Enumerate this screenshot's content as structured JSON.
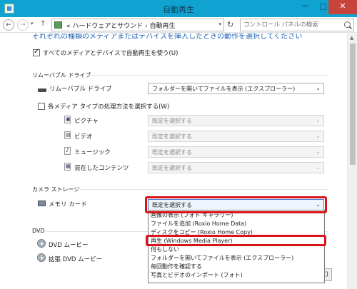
{
  "window": {
    "title": "自動再生",
    "minimize": "─",
    "maximize": "□",
    "close": "✕"
  },
  "nav": {
    "back": "←",
    "forward": "→",
    "history": "▾",
    "up": "↑",
    "address_prefix": "«",
    "breadcrumb": [
      "ハードウェアとサウンド",
      "自動再生"
    ],
    "breadcrumb_sep": "›",
    "address_dropdown": "▾",
    "refresh": "↻",
    "search_placeholder": "コントロール パネルの検索"
  },
  "intro_text": "それぞれの種類のメディアまたはデバイスを挿入したときの動作を選択してください",
  "use_autoplay": {
    "label": "すべてのメディアとデバイスで自動再生を使う(U)",
    "checked": true
  },
  "removable": {
    "section": "リムーバブル ドライブ",
    "drive_label": "リムーバブル ドライブ",
    "drive_value": "フォルダーを開いてファイルを表示 (エクスプローラー)",
    "per_media": {
      "label": "各メディア タイプの処理方法を選択する(W)",
      "checked": false
    },
    "media": [
      {
        "label": "ピクチャ",
        "value": "既定を選択する",
        "icon": "picture-icon"
      },
      {
        "label": "ビデオ",
        "value": "既定を選択する",
        "icon": "video-icon"
      },
      {
        "label": "ミュージック",
        "value": "既定を選択する",
        "icon": "music-icon"
      },
      {
        "label": "混在したコンテンツ",
        "value": "既定を選択する",
        "icon": "mixed-content-icon"
      }
    ]
  },
  "camera": {
    "section": "カメラ ストレージ",
    "memory_card_label": "メモリ カード",
    "memory_card_value": "既定を選択する"
  },
  "dvd": {
    "section": "DVD",
    "items": [
      {
        "label": "DVD ムービー"
      },
      {
        "label": "拡張 DVD ムービー"
      }
    ]
  },
  "dropdown_options": [
    "画像の表示 (フォト ギャラリー)",
    "ファイルを追加 (Roxio Home Data)",
    "ディスクをコピー (Roxio Home Copy)",
    "再生 (Windows Media Player)",
    "何もしない",
    "フォルダーを開いてファイルを表示 (エクスプローラー)",
    "毎回動作を確認する",
    "写真とビデオのインポート (フォト)"
  ],
  "dropdown_chevron": "⌄",
  "bottom_button_partial": "C)",
  "scroll_up": "▲"
}
